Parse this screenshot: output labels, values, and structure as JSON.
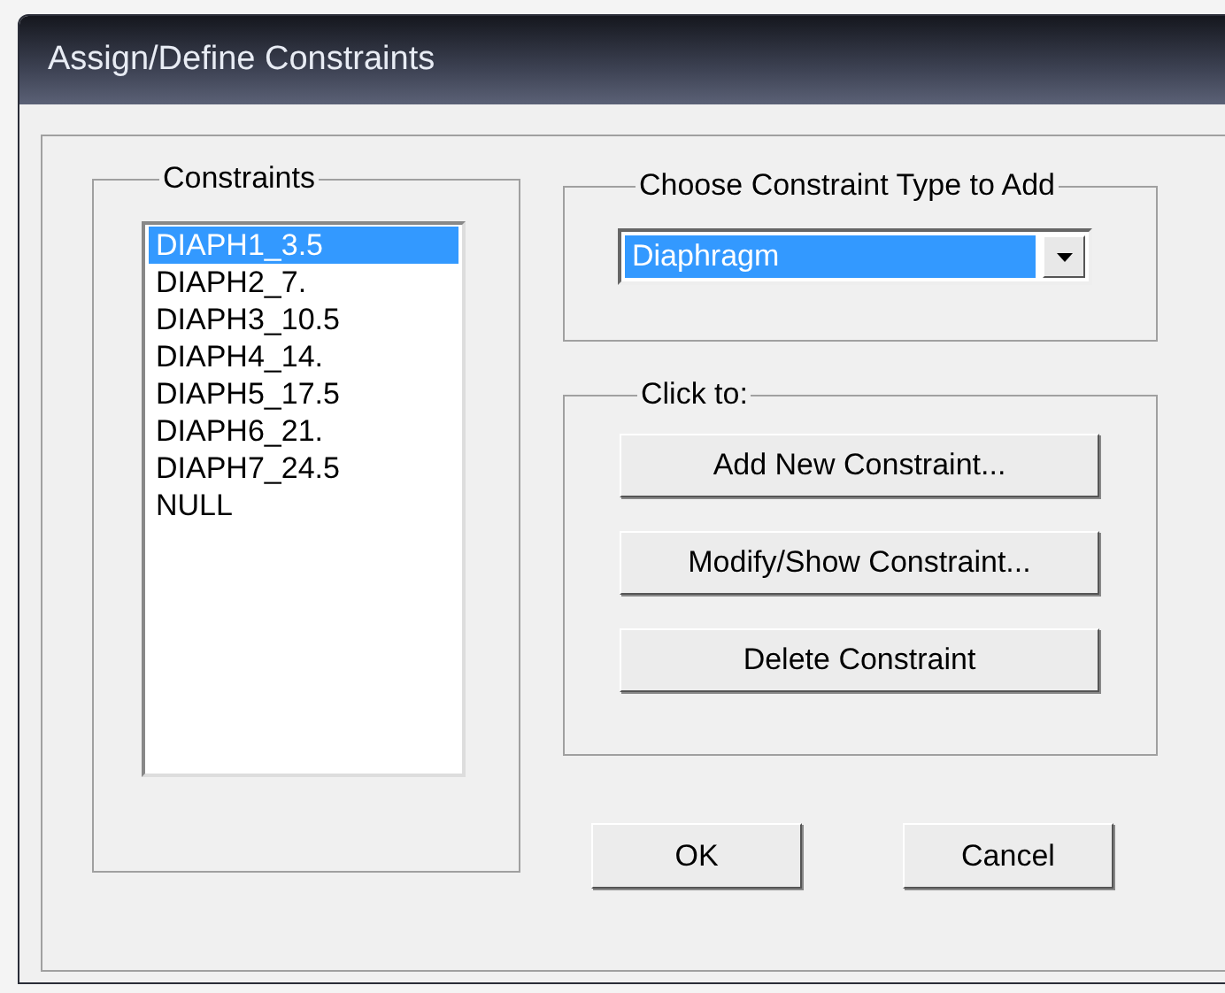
{
  "window": {
    "title": "Assign/Define Constraints"
  },
  "constraints": {
    "label": "Constraints",
    "items": [
      {
        "text": "DIAPH1_3.5",
        "selected": true
      },
      {
        "text": "DIAPH2_7.",
        "selected": false
      },
      {
        "text": "DIAPH3_10.5",
        "selected": false
      },
      {
        "text": "DIAPH4_14.",
        "selected": false
      },
      {
        "text": "DIAPH5_17.5",
        "selected": false
      },
      {
        "text": "DIAPH6_21.",
        "selected": false
      },
      {
        "text": "DIAPH7_24.5",
        "selected": false
      },
      {
        "text": "NULL",
        "selected": false
      }
    ]
  },
  "constraint_type": {
    "label": "Choose Constraint Type to Add",
    "value": "Diaphragm"
  },
  "click_to": {
    "label": "Click to:",
    "buttons": [
      "Add New Constraint...",
      "Modify/Show Constraint...",
      "Delete Constraint"
    ]
  },
  "buttons": [
    "OK",
    "Cancel"
  ]
}
